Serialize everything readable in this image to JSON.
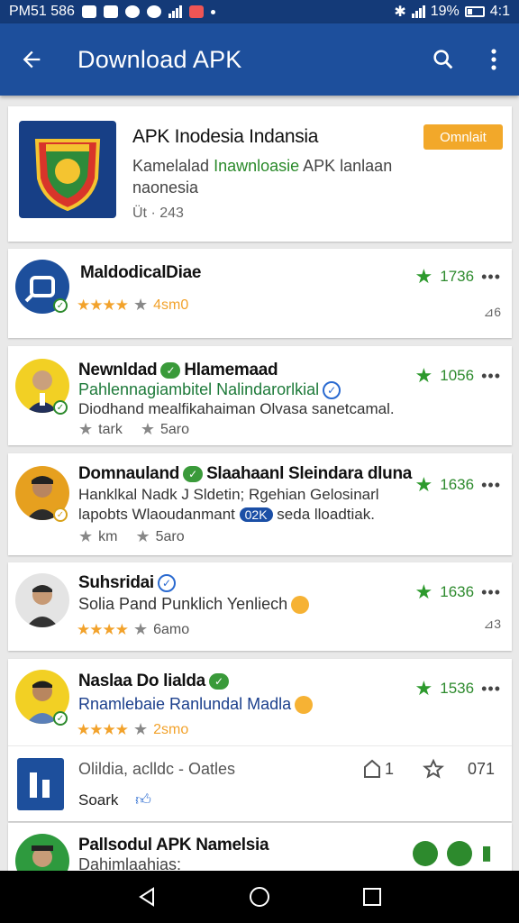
{
  "status": {
    "time": "PM51 586",
    "battery": "19%",
    "clock": "4:1"
  },
  "appbar": {
    "title": "Download APK",
    "back": "←"
  },
  "featured": {
    "title": "APK Inodesia Indansia",
    "button": "Omnlait",
    "desc_prefix": "Kamelalad ",
    "desc_highlight": "Inawnloasie",
    "desc_suffix": " APK lanlaan",
    "desc_line2": "naonesia",
    "meta": "Üt · 243"
  },
  "items": [
    {
      "title": "MaldodicalDiae",
      "stars": "★★★★",
      "meta": "4sm0",
      "rating": "1736",
      "side": "⊿6"
    },
    {
      "title": "Newnldad",
      "title_suffix": "Hlamemaad",
      "line1": "Pahlennagiambitel Nalindarorlkial",
      "line2": "Diodhand mealfikahaiman Olvasa sanetcamal.",
      "meta_left": "tark",
      "meta": "5aro",
      "rating": "1056"
    },
    {
      "title": "Domnauland",
      "title_suffix": "Slaahaanl Sleindara dluna",
      "line1": "Hanklkal Nadk J Sldetin; Rgehian Gelosinarl",
      "line2_a": "lapobts Wlaoudanmant",
      "line2_pill": "02K",
      "line2_b": "seda lloadtiak.",
      "meta_left": "km",
      "meta": "5aro",
      "rating": "1636"
    },
    {
      "title": "Suhsridai",
      "line1": "Solia Pand Punklich Yenliech",
      "stars": "★★★★",
      "meta": "6amo",
      "rating": "1636",
      "side": "⊿3"
    },
    {
      "title": "Naslaa Do lialda",
      "line1": "Rnamlebaie Ranlundal Madla",
      "stars": "★★★★",
      "meta": "2smo",
      "rating": "1536"
    }
  ],
  "action_row": {
    "text": "Olildia, aclldc - Oatles",
    "count1": "1",
    "count2": "071",
    "label": "Soark"
  },
  "last_item": {
    "title": "Pallsodul APK Namelsia",
    "line1": "Dahimlaahias:"
  },
  "colors": {
    "appbar": "#1d4f9c",
    "accent": "#f2a82a",
    "green": "#2d8a2d"
  }
}
